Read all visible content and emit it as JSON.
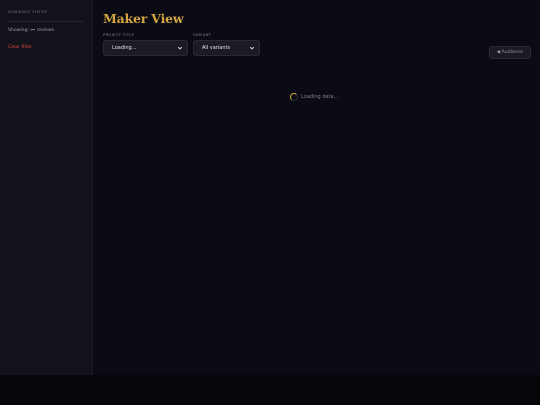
{
  "sidebar": {
    "heading": "AUDIENCE FILTER",
    "showing_prefix": "Showing:",
    "showing_value": "—",
    "showing_suffix": "reviews",
    "clear_filter": "Clear filter"
  },
  "main": {
    "title": "Maker View",
    "project_label": "PROJECT TITLE",
    "project_value": "Loading...",
    "variant_label": "VARIANT",
    "variant_value": "All variants",
    "audience_button": "◀ Audience",
    "loading_text": "Loading data..."
  },
  "colors": {
    "accent": "#d4a640",
    "danger": "#e04848",
    "background": "#0b0b13",
    "sidebar": "#12121a"
  },
  "icons": {
    "select_chevron": "chevron-down-icon",
    "spinner": "loading-spinner-icon"
  }
}
